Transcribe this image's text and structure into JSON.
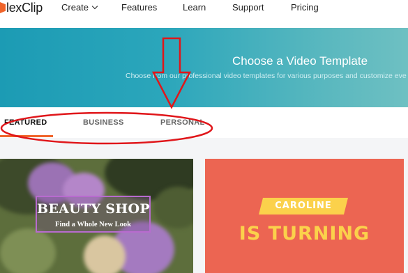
{
  "nav": {
    "logo_text": "lexClip",
    "items": [
      {
        "label": "Create"
      },
      {
        "label": "Features"
      },
      {
        "label": "Learn"
      },
      {
        "label": "Support"
      },
      {
        "label": "Pricing"
      }
    ]
  },
  "hero": {
    "title": "Choose a Video Template",
    "subtitle": "Choose from our professional video templates for various purposes and customize eve"
  },
  "tabs": [
    {
      "label": "FEATURED"
    },
    {
      "label": "BUSINESS"
    },
    {
      "label": "PERSONAL"
    }
  ],
  "cards": [
    {
      "title": "BEAUTY SHOP",
      "subtitle": "Find a Whole New Look"
    },
    {
      "title": "CAROLINE",
      "subtitle": "IS TURNING"
    }
  ],
  "colors": {
    "accent": "#f0642a",
    "annotation": "#e0161a",
    "hero_start": "#1c9bb4",
    "hero_end": "#6ec0c2",
    "card_coral": "#ec6552",
    "card_yellow": "#fbd14b"
  }
}
